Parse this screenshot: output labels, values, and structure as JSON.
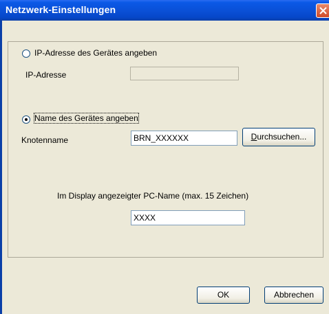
{
  "window": {
    "title": "Netzwerk-Einstellungen"
  },
  "ip_option": {
    "radio_label": "IP-Adresse des Gerätes angeben",
    "field_label": "IP-Adresse",
    "value": ""
  },
  "name_option": {
    "radio_label": "Name des Gerätes angeben",
    "node_label": "Knotenname",
    "node_value": "BRN_XXXXXX",
    "browse_underlined": "D",
    "browse_rest": "urchsuchen..."
  },
  "display": {
    "label": "Im Display angezeigter PC-Name (max. 15 Zeichen)",
    "value": "XXXX"
  },
  "buttons": {
    "ok": "OK",
    "cancel": "Abbrechen"
  }
}
